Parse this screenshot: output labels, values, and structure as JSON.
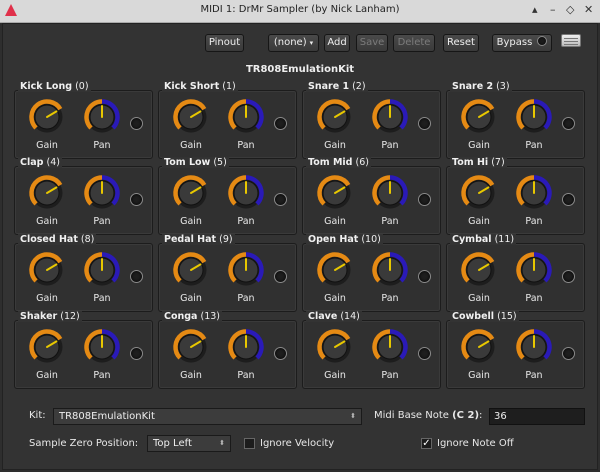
{
  "window": {
    "title": "MIDI 1: DrMr Sampler (by Nick Lanham)",
    "controls": {
      "shade": "▴",
      "minimize": "–",
      "maximize": "◇",
      "close": "✕"
    }
  },
  "toolbar": {
    "pinout": "Pinout",
    "preset": "(none)",
    "add": "Add",
    "save": "Save",
    "delete": "Delete",
    "reset": "Reset",
    "bypass": "Bypass"
  },
  "kit_title": "TR808EmulationKit",
  "colors": {
    "knob_ring": "#e58a14",
    "pan_ring": "#2a1ab8",
    "indicator": "#e8c800",
    "knob_body": "#3a3a3a"
  },
  "knob_labels": {
    "gain": "Gain",
    "pan": "Pan"
  },
  "samples": [
    {
      "name": "Kick Long",
      "num": "(0)",
      "gain": 0.72,
      "pan": 0.5
    },
    {
      "name": "Kick Short",
      "num": "(1)",
      "gain": 0.72,
      "pan": 0.5
    },
    {
      "name": "Snare 1",
      "num": "(2)",
      "gain": 0.72,
      "pan": 0.5
    },
    {
      "name": "Snare 2",
      "num": "(3)",
      "gain": 0.72,
      "pan": 0.5
    },
    {
      "name": "Clap",
      "num": "(4)",
      "gain": 0.72,
      "pan": 0.5
    },
    {
      "name": "Tom Low",
      "num": "(5)",
      "gain": 0.72,
      "pan": 0.5
    },
    {
      "name": "Tom Mid",
      "num": "(6)",
      "gain": 0.72,
      "pan": 0.5
    },
    {
      "name": "Tom Hi",
      "num": "(7)",
      "gain": 0.72,
      "pan": 0.5
    },
    {
      "name": "Closed Hat",
      "num": "(8)",
      "gain": 0.72,
      "pan": 0.5
    },
    {
      "name": "Pedal Hat",
      "num": "(9)",
      "gain": 0.72,
      "pan": 0.5
    },
    {
      "name": "Open Hat",
      "num": "(10)",
      "gain": 0.72,
      "pan": 0.5
    },
    {
      "name": "Cymbal",
      "num": "(11)",
      "gain": 0.72,
      "pan": 0.5
    },
    {
      "name": "Shaker",
      "num": "(12)",
      "gain": 0.72,
      "pan": 0.5
    },
    {
      "name": "Conga",
      "num": "(13)",
      "gain": 0.72,
      "pan": 0.5
    },
    {
      "name": "Clave",
      "num": "(14)",
      "gain": 0.72,
      "pan": 0.5
    },
    {
      "name": "Cowbell",
      "num": "(15)",
      "gain": 0.72,
      "pan": 0.5
    }
  ],
  "bottom": {
    "kit_label": "Kit:",
    "kit_value": "TR808EmulationKit",
    "midi_base_label": "Midi Base Note (C 2):",
    "midi_base_value": "36",
    "zero_pos_label": "Sample Zero Position:",
    "zero_pos_value": "Top Left",
    "ignore_velocity_label": "Ignore Velocity",
    "ignore_velocity_checked": false,
    "ignore_note_off_label": "Ignore Note Off",
    "ignore_note_off_checked": true
  }
}
